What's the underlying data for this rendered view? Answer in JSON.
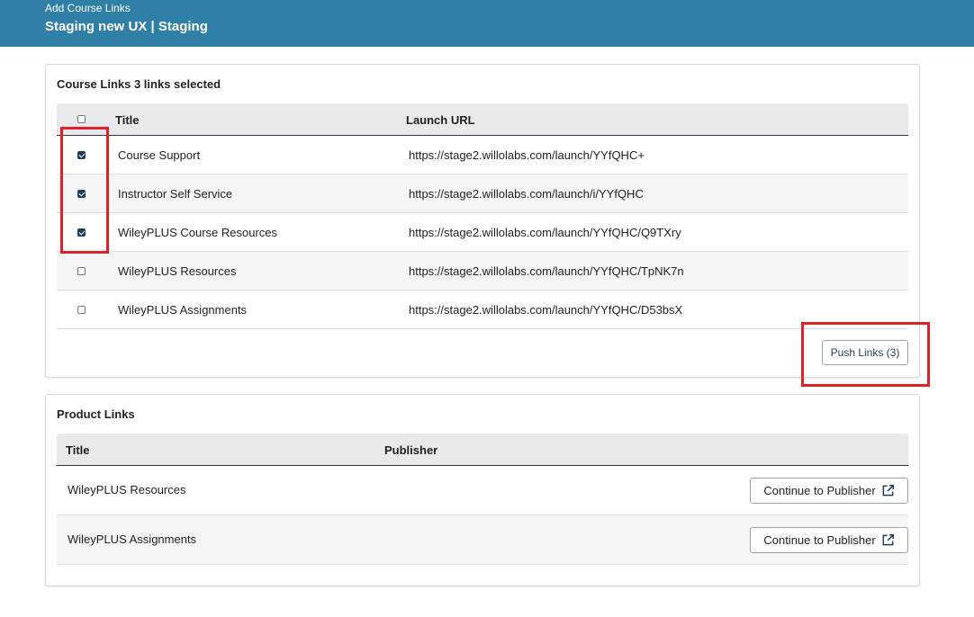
{
  "header": {
    "subtitle": "Add Course Links",
    "title": "Staging new UX | Staging",
    "background": "#2f7fa6"
  },
  "course_links": {
    "heading": "Course Links 3 links selected",
    "columns": {
      "title": "Title",
      "url": "Launch URL"
    },
    "rows": [
      {
        "title": "Course Support",
        "url": "https://stage2.willolabs.com/launch/YYfQHC+",
        "checked": true
      },
      {
        "title": "Instructor Self Service",
        "url": "https://stage2.willolabs.com/launch/i/YYfQHC",
        "checked": true
      },
      {
        "title": "WileyPLUS Course Resources",
        "url": "https://stage2.willolabs.com/launch/YYfQHC/Q9TXry",
        "checked": true
      },
      {
        "title": "WileyPLUS Resources",
        "url": "https://stage2.willolabs.com/launch/YYfQHC/TpNK7n",
        "checked": false
      },
      {
        "title": "WileyPLUS Assignments",
        "url": "https://stage2.willolabs.com/launch/YYfQHC/D53bsX",
        "checked": false
      }
    ],
    "push_button": "Push Links (3)"
  },
  "product_links": {
    "heading": "Product Links",
    "columns": {
      "title": "Title",
      "publisher": "Publisher"
    },
    "rows": [
      {
        "title": "WileyPLUS Resources",
        "button": "Continue to Publisher",
        "icon": "external-link-icon"
      },
      {
        "title": "WileyPLUS Assignments",
        "button": "Continue to Publisher",
        "icon": "external-link-icon"
      }
    ]
  },
  "annotation_color": "#e0202a"
}
